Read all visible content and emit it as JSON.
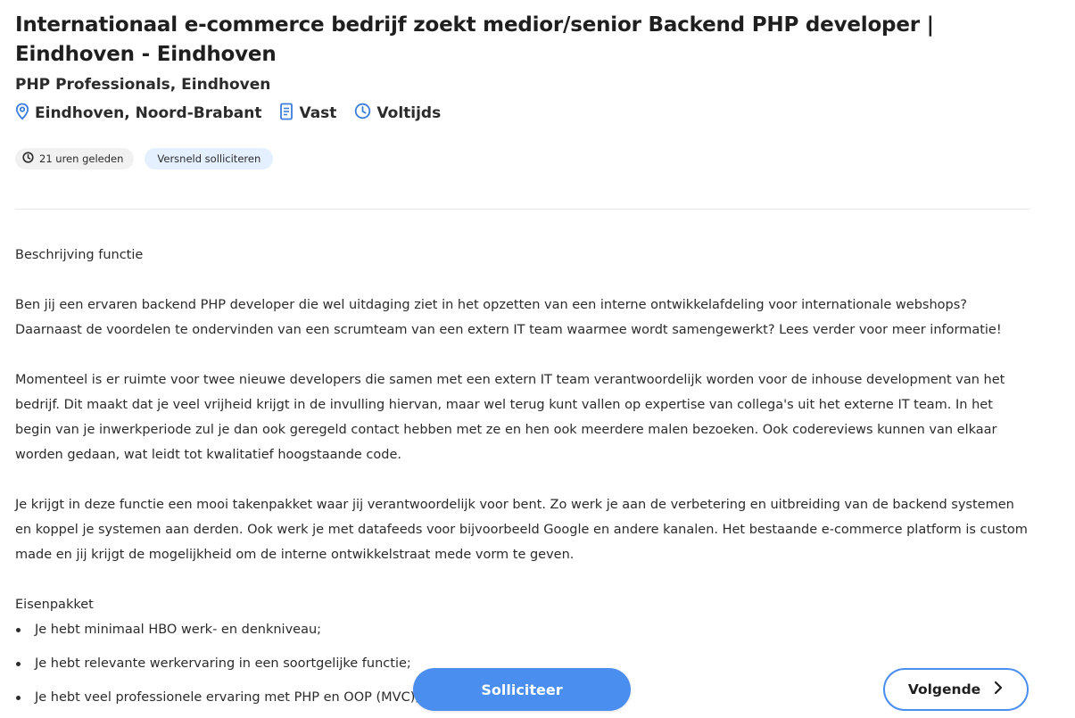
{
  "job": {
    "title": "Internationaal e-commerce bedrijf zoekt medior/senior Backend PHP developer | Eindhoven - Eindhoven",
    "company": "PHP Professionals, Eindhoven",
    "location": "Eindhoven, Noord-Brabant",
    "contract": "Vast",
    "hours": "Voltijds"
  },
  "badges": {
    "posted": "21 uren geleden",
    "quick_apply": "Versneld solliciteren"
  },
  "description": {
    "heading": "Beschrijving functie",
    "paragraphs": [
      "Ben jij een ervaren backend PHP developer die wel uitdaging ziet in het opzetten van een interne ontwikkelafdeling voor internationale webshops? Daarnaast de voordelen te ondervinden van een scrumteam van een extern IT team waarmee wordt samengewerkt? Lees verder voor meer informatie!",
      "Momenteel is er ruimte voor twee nieuwe developers die samen met een extern IT team verantwoordelijk worden voor de inhouse development van het bedrijf. Dit maakt dat je veel vrijheid krijgt in de invulling hiervan, maar wel terug kunt vallen op expertise van collega's uit het externe IT team. In het begin van je inwerkperiode zul je dan ook geregeld contact hebben met ze en hen ook meerdere malen bezoeken. Ook codereviews kunnen van elkaar worden gedaan, wat leidt tot kwalitatief hoogstaande code.",
      "Je krijgt in deze functie een mooi takenpakket waar jij verantwoordelijk voor bent. Zo werk je aan de verbetering en uitbreiding van de backend systemen en koppel je systemen aan derden. Ook werk je met datafeeds voor bijvoorbeeld Google en andere kanalen. Het bestaande e-commerce platform is custom made en jij krijgt de mogelijkheid om de interne ontwikkelstraat mede vorm te geven."
    ],
    "requirements_heading": "Eisenpakket",
    "requirements": [
      "Je hebt minimaal HBO werk- en denkniveau;",
      "Je hebt relevante werkervaring in een soortgelijke functie;",
      "Je hebt veel professionele ervaring met PHP en OOP (MVC);"
    ]
  },
  "actions": {
    "apply_label": "Solliciteer",
    "next_label": "Volgende"
  },
  "icons": {
    "location": "map-pin-icon",
    "contract": "document-icon",
    "hours": "clock-icon",
    "posted": "clock-icon",
    "next": "chevron-right-icon"
  },
  "colors": {
    "accent": "#4a8ef0",
    "icon_blue": "#3b7ddd",
    "quick_apply_bg": "#e4efff",
    "posted_bg": "#f1f1f1"
  }
}
